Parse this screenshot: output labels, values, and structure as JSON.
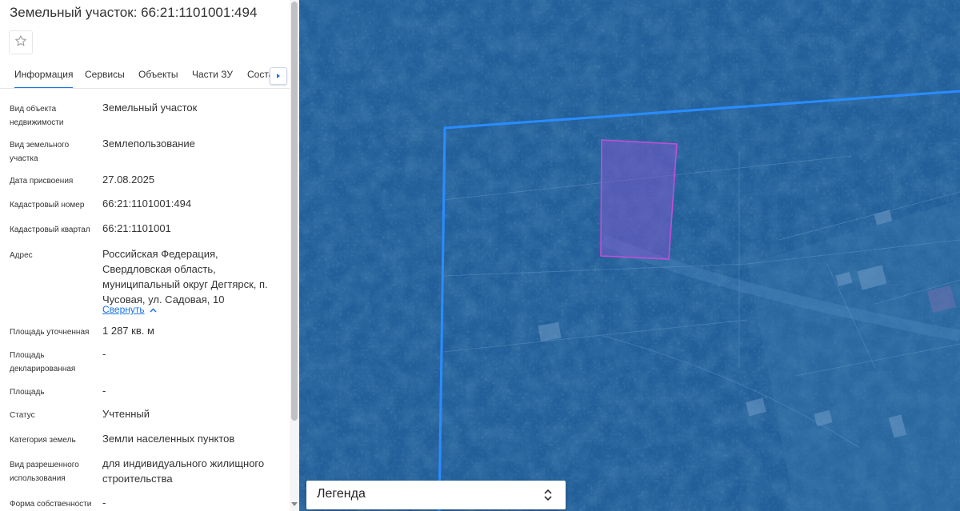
{
  "title": "Земельный участок: 66:21:1101001:494",
  "favorite_icon": "star-outline-icon",
  "tabs": [
    {
      "label": "Информация",
      "active": true
    },
    {
      "label": "Сервисы",
      "active": false
    },
    {
      "label": "Объекты",
      "active": false
    },
    {
      "label": "Части ЗУ",
      "active": false
    },
    {
      "label": "Соста",
      "active": false
    }
  ],
  "tabs_scroll_icon": "chevron-right-icon",
  "fields": [
    {
      "label": "Вид объекта недвижимости",
      "value": "Земельный участок"
    },
    {
      "label": "Вид земельного участка",
      "value": "Землепользование"
    },
    {
      "label": "Дата присвоения",
      "value": "27.08.2025"
    },
    {
      "label": "Кадастровый номер",
      "value": "66:21:1101001:494"
    },
    {
      "label": "Кадастровый квартал",
      "value": "66:21:1101001"
    },
    {
      "label": "Адрес",
      "value": "Российская Федерация, Свердловская область, муниципальный округ Дегтярск, п. Чусовая, ул. Садовая, 10"
    },
    {
      "label": "Площадь уточненная",
      "value": "1 287 кв. м"
    },
    {
      "label": "Площадь декларированная",
      "value": "-"
    },
    {
      "label": "Площадь",
      "value": "-"
    },
    {
      "label": "Статус",
      "value": "Учтенный"
    },
    {
      "label": "Категория земель",
      "value": "Земли населенных пунктов"
    },
    {
      "label": "Вид разрешенного использования",
      "value": "для индивидуального жилищного строительства"
    },
    {
      "label": "Форма собственности",
      "value": "-"
    }
  ],
  "address_collapse": "Свернуть",
  "legend": {
    "label": "Легенда"
  },
  "colors": {
    "accent": "#1a73e8",
    "quarter_boundary": "#2a8cff",
    "parcel_highlight": "#b44fd6",
    "map_tint": "#1f5d98"
  }
}
